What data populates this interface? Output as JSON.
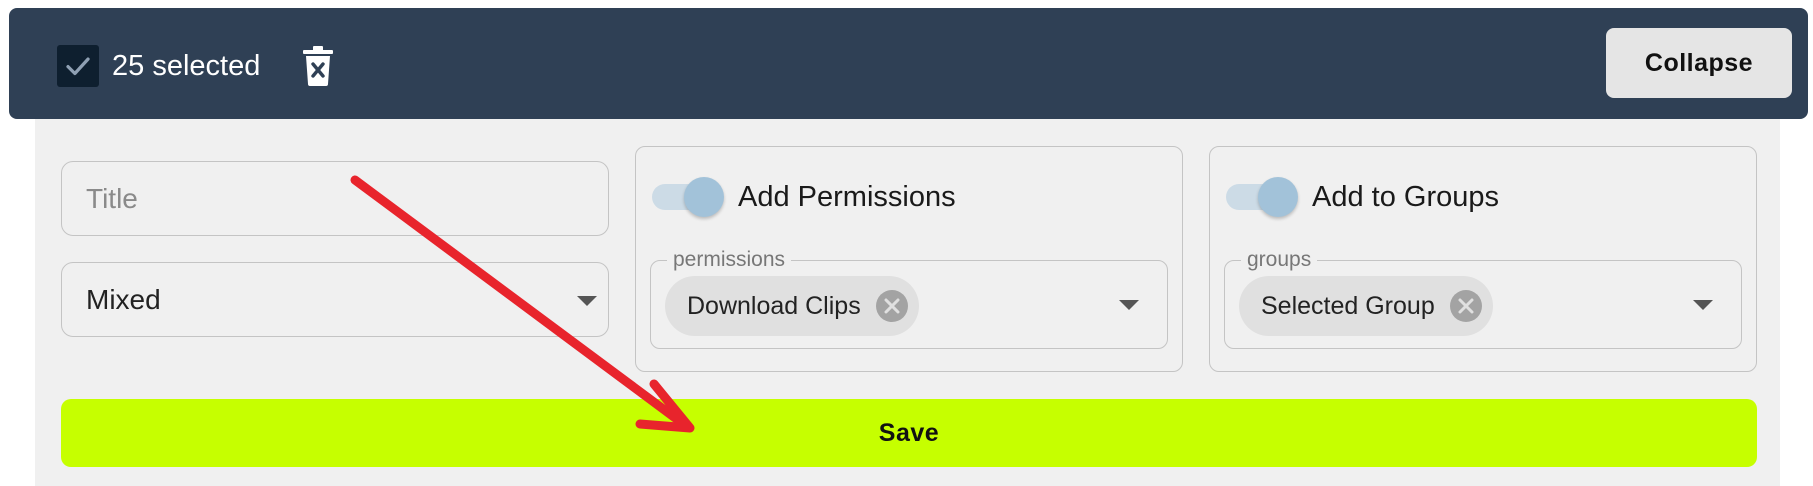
{
  "toolbar": {
    "selected_count_text": "25 selected",
    "collapse_label": "Collapse",
    "background_color": "#2f4055"
  },
  "form": {
    "title_placeholder": "Title",
    "title_value": "",
    "mode_select_value": "Mixed"
  },
  "permissions": {
    "toggle_label": "Add Permissions",
    "toggle_on": true,
    "legend": "permissions",
    "chips": [
      {
        "label": "Download Clips"
      }
    ]
  },
  "groups": {
    "toggle_label": "Add to Groups",
    "toggle_on": true,
    "legend": "groups",
    "chips": [
      {
        "label": "Selected Group"
      }
    ]
  },
  "save": {
    "label": "Save",
    "color": "#c6ff00"
  },
  "icons": {
    "checkbox": "checkmark-icon",
    "delete": "trash-icon",
    "chip_remove": "close-circle-icon",
    "dropdown": "caret-down-icon"
  },
  "annotation_color": "#e8242c"
}
